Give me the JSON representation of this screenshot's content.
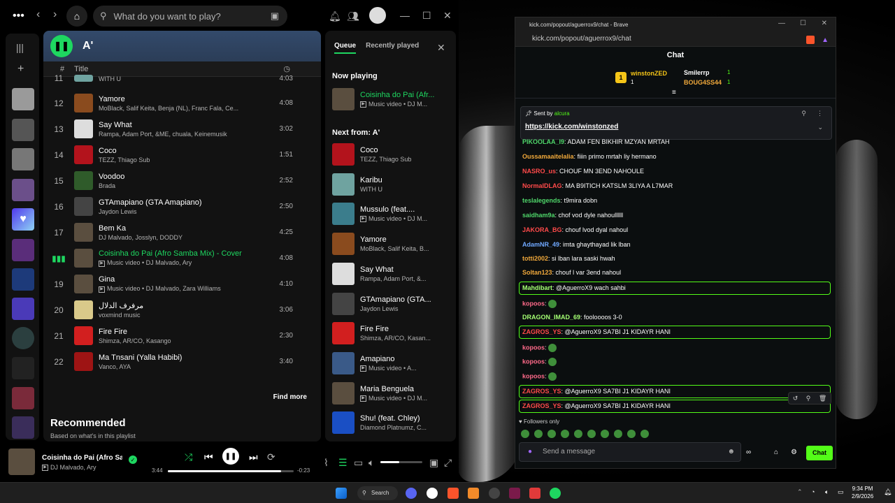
{
  "spotify": {
    "search_placeholder": "What do you want to play?",
    "playlist_title": "A'",
    "col_num": "#",
    "col_title": "Title",
    "partial_row": {
      "num": "11",
      "sub": "WITH U",
      "dur": "4:03"
    },
    "tracks": [
      {
        "num": "12",
        "name": "Yamore",
        "sub": "MoBlack, Salif Keita, Benja (NL), Franc Fala, Ce...",
        "dur": "4:08",
        "color": "#8a4b1e"
      },
      {
        "num": "13",
        "name": "Say What",
        "sub": "Rampa, Adam Port, &ME, chuala, Keinemusik",
        "dur": "3:02",
        "color": "#ddd"
      },
      {
        "num": "14",
        "name": "Coco",
        "sub": "TEZZ, Thiago Sub",
        "dur": "1:51",
        "color": "#b3131c"
      },
      {
        "num": "15",
        "name": "Voodoo",
        "sub": "Brada",
        "dur": "2:52",
        "color": "#2f5b2a"
      },
      {
        "num": "16",
        "name": "GTAmapiano (GTA Amapiano)",
        "sub": "Jaydon Lewis",
        "dur": "2:50",
        "color": "#444"
      },
      {
        "num": "17",
        "name": "Bem Ka",
        "sub": "DJ Malvado, Josslyn, DODDY",
        "dur": "4:25",
        "color": "#5a4e3f"
      },
      {
        "num": "",
        "name": "Coisinha do Pai (Afro Samba Mix) - Cover",
        "sub": "Music video • DJ Malvado, Ary",
        "dur": "4:08",
        "color": "#5a4e3f",
        "playing": true
      },
      {
        "num": "19",
        "name": "Gina",
        "sub": "Music video • DJ Malvado, Zara Williams",
        "dur": "4:10",
        "color": "#5a4e3f"
      },
      {
        "num": "20",
        "name": "مرفرف الدلال",
        "sub": "voxmind music",
        "dur": "3:06",
        "color": "#d9c98a"
      },
      {
        "num": "21",
        "name": "Fire Fire",
        "sub": "Shimza, AR/CO, Kasango",
        "dur": "2:30",
        "color": "#d21f1f"
      },
      {
        "num": "22",
        "name": "Ma Tnsani (Yalla Habibi)",
        "sub": "Vanco, AYA",
        "dur": "3:40",
        "color": "#9e1414"
      }
    ],
    "find_more": "Find more",
    "recommended": "Recommended",
    "recommended_sub": "Based on what's in this playlist",
    "queue": {
      "tab_queue": "Queue",
      "tab_recent": "Recently played",
      "now_playing_label": "Now playing",
      "now_playing": {
        "name": "Coisinha do Pai (Afr...",
        "sub": "Music video • DJ M..."
      },
      "next_label": "Next from: A'",
      "items": [
        {
          "name": "Coco",
          "sub": "TEZZ, Thiago Sub",
          "color": "#b3131c"
        },
        {
          "name": "Karibu",
          "sub": "WITH U",
          "color": "#6fa3a0"
        },
        {
          "name": "Mussulo (feat....",
          "sub": "Music video • DJ M...",
          "color": "#3b7d8c"
        },
        {
          "name": "Yamore",
          "sub": "MoBlack, Salif Keita, B...",
          "color": "#8a4b1e"
        },
        {
          "name": "Say What",
          "sub": "Rampa, Adam Port, &...",
          "color": "#ddd"
        },
        {
          "name": "GTAmapiano (GTA...",
          "sub": "Jaydon Lewis",
          "color": "#444"
        },
        {
          "name": "Fire Fire",
          "sub": "Shimza, AR/CO, Kasan...",
          "color": "#d21f1f"
        },
        {
          "name": "Amapiano",
          "sub": "Music video • A...",
          "color": "#3a5a88"
        },
        {
          "name": "Maria Benguela",
          "sub": "Music video • DJ M...",
          "color": "#5a4e3f"
        },
        {
          "name": "Shu! (feat. Chley)",
          "sub": "Diamond Platnumz, C...",
          "color": "#1a4fc4"
        }
      ]
    },
    "player": {
      "name": "Coisinha do Pai (Afro Samb",
      "artist": "DJ Malvado, Ary",
      "elapsed": "3:44",
      "remaining": "-0:23",
      "progress": 0.9
    }
  },
  "brave": {
    "title": "kick.com/popout/aguerrox9/chat - Brave",
    "url": "kick.com/popout/aguerrox9/chat",
    "chat_header": "Chat",
    "gifters": [
      {
        "rank": "1",
        "name": "winstonZED",
        "count": "1"
      },
      {
        "rank": "",
        "name": "Smilerrp",
        "count": "1"
      },
      {
        "rank": "",
        "name": "BOUG4SS44",
        "count": "1"
      }
    ],
    "pinned": {
      "sent_by": "Sent by",
      "user": "alcura",
      "link": "https://kick.com/winstonzed"
    },
    "messages": [
      {
        "user": "PIKOOLAA_I9",
        "text": "ADAM FEN BIKHIR MZYAN MRTAH",
        "color": "#4fd66a"
      },
      {
        "user": "Oussamaaitelalia",
        "text": "fiiin primo mrtah liy hermano",
        "color": "#f1a93b"
      },
      {
        "user": "NASRO_us",
        "text": "CHOUF MN 3END NAHOULE",
        "color": "#ff4a4a"
      },
      {
        "user": "NormalDLAG",
        "text": "MA B9ITICH KATSLM 3LIYA A L7MAR",
        "color": "#ff4a4a"
      },
      {
        "user": "teslalegends",
        "text": "t9mira dobn",
        "color": "#4fd66a"
      },
      {
        "user": "saidham9a",
        "text": "chof vod dyle nahoullllll",
        "color": "#4fd66a"
      },
      {
        "user": "JAKORA_BG",
        "text": "chouf lvod dyal nahoul",
        "color": "#ff4a4a"
      },
      {
        "user": "AdamNR_49",
        "text": "imta ghaythayad lik lban",
        "color": "#6fa8ff"
      },
      {
        "user": "totti2002",
        "text": "si lban lara saski hwah",
        "color": "#f1a93b"
      },
      {
        "user": "Soltan123",
        "text": "chouf l var 3end nahoul",
        "color": "#f1a93b"
      },
      {
        "user": "Mahdibart",
        "text": "@AguerroX9 wach sahbi",
        "color": "#a4ff73",
        "hl": true
      },
      {
        "user": "kopoos",
        "text": "",
        "color": "#ff6a8a",
        "emote": true
      },
      {
        "user": "DRAGON_IMAD_69",
        "text": "fooloooos 3-0",
        "color": "#a4ff73"
      },
      {
        "user": "ZAGROS_YS",
        "text": "@AguerroX9 SA7BI J1 KIDAYR HANI",
        "color": "#ff4a4a",
        "hl": true
      },
      {
        "user": "kopoos",
        "text": "",
        "color": "#ff6a8a",
        "emote": true
      },
      {
        "user": "kopoos",
        "text": "",
        "color": "#ff6a8a",
        "emote": true
      },
      {
        "user": "kopoos",
        "text": "",
        "color": "#ff6a8a",
        "emote": true
      },
      {
        "user": "ZAGROS_YS",
        "text": "@AguerroX9 SA7BI J1 KIDAYR HANI",
        "color": "#ff4a4a",
        "hl": true
      },
      {
        "user": "ZAGROS_YS",
        "text": "@AguerroX9 SA7BI J1 KIDAYR HANI",
        "color": "#ff4a4a",
        "hl": true
      }
    ],
    "followers_only": "Followers only",
    "input_placeholder": "Send a message",
    "send_label": "Chat"
  },
  "taskbar": {
    "search": "Search",
    "time": "9:34 PM",
    "date": "2/9/2026"
  },
  "colors": {
    "spotify_green": "#1ed760",
    "kick_green": "#53fc18"
  }
}
